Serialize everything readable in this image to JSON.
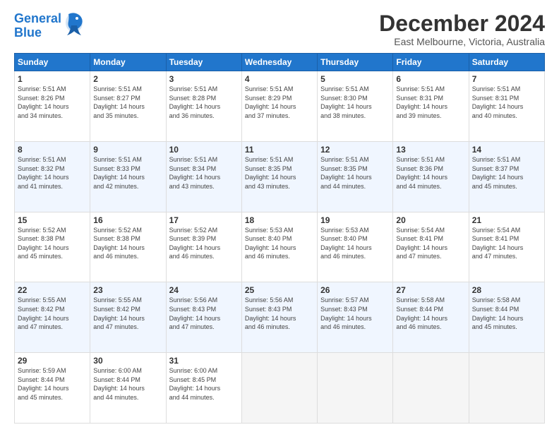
{
  "logo": {
    "line1": "General",
    "line2": "Blue"
  },
  "title": "December 2024",
  "subtitle": "East Melbourne, Victoria, Australia",
  "weekdays": [
    "Sunday",
    "Monday",
    "Tuesday",
    "Wednesday",
    "Thursday",
    "Friday",
    "Saturday"
  ],
  "weeks": [
    [
      {
        "day": "1",
        "info": "Sunrise: 5:51 AM\nSunset: 8:26 PM\nDaylight: 14 hours\nand 34 minutes."
      },
      {
        "day": "2",
        "info": "Sunrise: 5:51 AM\nSunset: 8:27 PM\nDaylight: 14 hours\nand 35 minutes."
      },
      {
        "day": "3",
        "info": "Sunrise: 5:51 AM\nSunset: 8:28 PM\nDaylight: 14 hours\nand 36 minutes."
      },
      {
        "day": "4",
        "info": "Sunrise: 5:51 AM\nSunset: 8:29 PM\nDaylight: 14 hours\nand 37 minutes."
      },
      {
        "day": "5",
        "info": "Sunrise: 5:51 AM\nSunset: 8:30 PM\nDaylight: 14 hours\nand 38 minutes."
      },
      {
        "day": "6",
        "info": "Sunrise: 5:51 AM\nSunset: 8:31 PM\nDaylight: 14 hours\nand 39 minutes."
      },
      {
        "day": "7",
        "info": "Sunrise: 5:51 AM\nSunset: 8:31 PM\nDaylight: 14 hours\nand 40 minutes."
      }
    ],
    [
      {
        "day": "8",
        "info": "Sunrise: 5:51 AM\nSunset: 8:32 PM\nDaylight: 14 hours\nand 41 minutes."
      },
      {
        "day": "9",
        "info": "Sunrise: 5:51 AM\nSunset: 8:33 PM\nDaylight: 14 hours\nand 42 minutes."
      },
      {
        "day": "10",
        "info": "Sunrise: 5:51 AM\nSunset: 8:34 PM\nDaylight: 14 hours\nand 43 minutes."
      },
      {
        "day": "11",
        "info": "Sunrise: 5:51 AM\nSunset: 8:35 PM\nDaylight: 14 hours\nand 43 minutes."
      },
      {
        "day": "12",
        "info": "Sunrise: 5:51 AM\nSunset: 8:35 PM\nDaylight: 14 hours\nand 44 minutes."
      },
      {
        "day": "13",
        "info": "Sunrise: 5:51 AM\nSunset: 8:36 PM\nDaylight: 14 hours\nand 44 minutes."
      },
      {
        "day": "14",
        "info": "Sunrise: 5:51 AM\nSunset: 8:37 PM\nDaylight: 14 hours\nand 45 minutes."
      }
    ],
    [
      {
        "day": "15",
        "info": "Sunrise: 5:52 AM\nSunset: 8:38 PM\nDaylight: 14 hours\nand 45 minutes."
      },
      {
        "day": "16",
        "info": "Sunrise: 5:52 AM\nSunset: 8:38 PM\nDaylight: 14 hours\nand 46 minutes."
      },
      {
        "day": "17",
        "info": "Sunrise: 5:52 AM\nSunset: 8:39 PM\nDaylight: 14 hours\nand 46 minutes."
      },
      {
        "day": "18",
        "info": "Sunrise: 5:53 AM\nSunset: 8:40 PM\nDaylight: 14 hours\nand 46 minutes."
      },
      {
        "day": "19",
        "info": "Sunrise: 5:53 AM\nSunset: 8:40 PM\nDaylight: 14 hours\nand 46 minutes."
      },
      {
        "day": "20",
        "info": "Sunrise: 5:54 AM\nSunset: 8:41 PM\nDaylight: 14 hours\nand 47 minutes."
      },
      {
        "day": "21",
        "info": "Sunrise: 5:54 AM\nSunset: 8:41 PM\nDaylight: 14 hours\nand 47 minutes."
      }
    ],
    [
      {
        "day": "22",
        "info": "Sunrise: 5:55 AM\nSunset: 8:42 PM\nDaylight: 14 hours\nand 47 minutes."
      },
      {
        "day": "23",
        "info": "Sunrise: 5:55 AM\nSunset: 8:42 PM\nDaylight: 14 hours\nand 47 minutes."
      },
      {
        "day": "24",
        "info": "Sunrise: 5:56 AM\nSunset: 8:43 PM\nDaylight: 14 hours\nand 47 minutes."
      },
      {
        "day": "25",
        "info": "Sunrise: 5:56 AM\nSunset: 8:43 PM\nDaylight: 14 hours\nand 46 minutes."
      },
      {
        "day": "26",
        "info": "Sunrise: 5:57 AM\nSunset: 8:43 PM\nDaylight: 14 hours\nand 46 minutes."
      },
      {
        "day": "27",
        "info": "Sunrise: 5:58 AM\nSunset: 8:44 PM\nDaylight: 14 hours\nand 46 minutes."
      },
      {
        "day": "28",
        "info": "Sunrise: 5:58 AM\nSunset: 8:44 PM\nDaylight: 14 hours\nand 45 minutes."
      }
    ],
    [
      {
        "day": "29",
        "info": "Sunrise: 5:59 AM\nSunset: 8:44 PM\nDaylight: 14 hours\nand 45 minutes."
      },
      {
        "day": "30",
        "info": "Sunrise: 6:00 AM\nSunset: 8:44 PM\nDaylight: 14 hours\nand 44 minutes."
      },
      {
        "day": "31",
        "info": "Sunrise: 6:00 AM\nSunset: 8:45 PM\nDaylight: 14 hours\nand 44 minutes."
      },
      null,
      null,
      null,
      null
    ]
  ]
}
